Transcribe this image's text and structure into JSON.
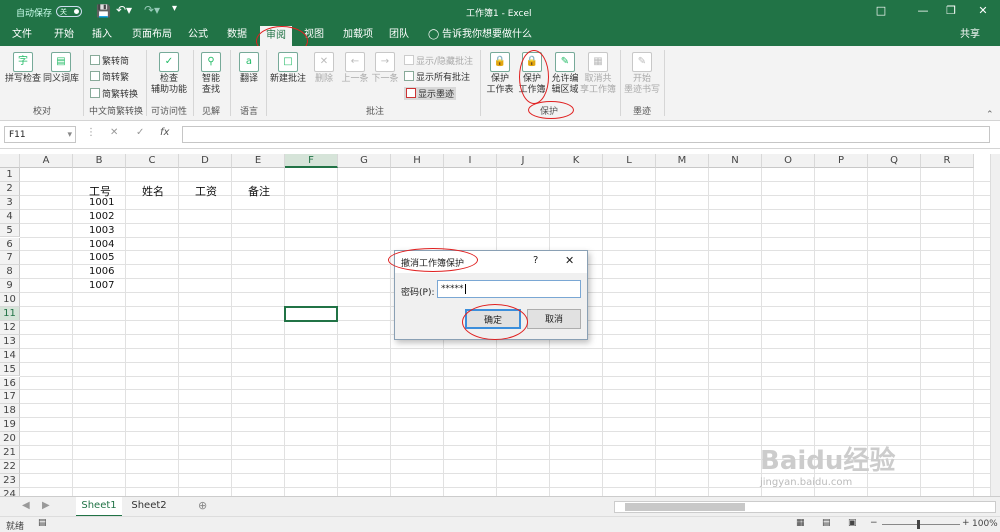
{
  "titlebar": {
    "autosave_label": "自动保存",
    "autosave_state": "关",
    "title": "工作簿1 - Excel"
  },
  "menu": {
    "tabs": [
      "文件",
      "开始",
      "插入",
      "页面布局",
      "公式",
      "数据",
      "审阅",
      "视图",
      "加载项",
      "团队"
    ],
    "active": "审阅",
    "tell_me": "告诉我你想要做什么",
    "share": "共享"
  },
  "ribbon": {
    "proofing": {
      "spell": "拼写检查",
      "thesaurus": "同义词库",
      "group": "校对"
    },
    "chinese": {
      "t2s": "繁转简",
      "s2t": "简转繁",
      "convert": "简繁转换",
      "group": "中文简繁转换"
    },
    "access": {
      "check1": "检查",
      "check2": "辅助功能",
      "group": "可访问性"
    },
    "insights": {
      "smart1": "智能",
      "smart2": "查找",
      "group": "见解"
    },
    "language": {
      "translate": "翻译",
      "group": "语言"
    },
    "comments": {
      "new": "新建批注",
      "delete": "删除",
      "prev": "上一条",
      "next": "下一条",
      "showhide": "显示/隐藏批注",
      "showall": "显示所有批注",
      "ink": "显示墨迹",
      "group": "批注"
    },
    "protect": {
      "sheet1": "保护",
      "sheet2": "工作表",
      "wb1": "保护",
      "wb2": "工作簿",
      "allow1": "允许编",
      "allow2": "辑区域",
      "unshare1": "取消共",
      "unshare2": "享工作簿",
      "group": "保护"
    },
    "ink": {
      "start1": "开始",
      "start2": "墨迹书写",
      "group": "墨迹"
    }
  },
  "formula": {
    "namebox": "F11",
    "fx": "fx"
  },
  "grid": {
    "columns": [
      "A",
      "B",
      "C",
      "D",
      "E",
      "F",
      "G",
      "H",
      "I",
      "J",
      "K",
      "L",
      "M",
      "N",
      "O",
      "P",
      "Q",
      "R"
    ],
    "rows": [
      "1",
      "2",
      "3",
      "4",
      "5",
      "6",
      "7",
      "8",
      "9",
      "10",
      "11",
      "12",
      "13",
      "14",
      "15",
      "16",
      "17",
      "18",
      "19",
      "20",
      "21",
      "22",
      "23",
      "24"
    ],
    "headers": [
      "工号",
      "姓名",
      "工资",
      "备注"
    ],
    "ids": [
      "1001",
      "1002",
      "1003",
      "1004",
      "1005",
      "1006",
      "1007"
    ],
    "selected_col": "F",
    "selected_row": "11"
  },
  "sheets": {
    "tabs": [
      "Sheet1",
      "Sheet2"
    ],
    "active": "Sheet1"
  },
  "status": {
    "ready": "就绪",
    "zoom": "100%"
  },
  "dialog": {
    "title": "撤消工作簿保护",
    "help": "?",
    "close": "✕",
    "password_label": "密码(P):",
    "password_value": "*****",
    "ok": "确定",
    "cancel": "取消"
  },
  "watermark": "Baidu经验",
  "watermark_sub": "jingyan.baidu.com",
  "accent": "#217346"
}
